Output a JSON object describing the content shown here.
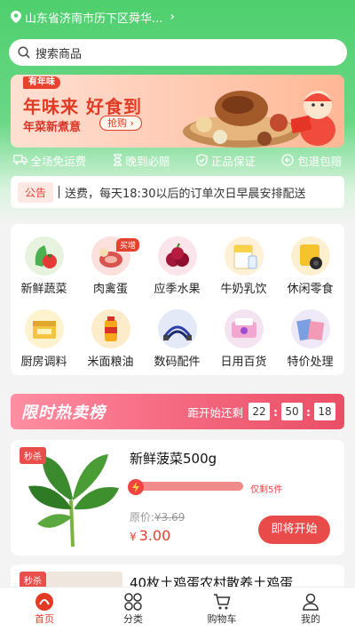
{
  "location": {
    "text": "山东省济南市历下区舜华...",
    "chevron": "›"
  },
  "search": {
    "placeholder": "搜索商品"
  },
  "banner": {
    "tag": "有年味",
    "title": "年味来 好食到",
    "subtitle": "年菜新煮意",
    "button": "抢购 ›"
  },
  "features": [
    {
      "icon": "truck-icon",
      "label": "全场免运费"
    },
    {
      "icon": "hourglass-icon",
      "label": "晚到必赔"
    },
    {
      "icon": "shield-check-icon",
      "label": "正品保证"
    },
    {
      "icon": "return-icon",
      "label": "包退包赔"
    }
  ],
  "notice": {
    "label": "公告",
    "text": "送费，每天18:30以后的订单次日早晨安排配送"
  },
  "categories": [
    {
      "label": "新鲜蔬菜",
      "icon": "vegetables-icon",
      "color": "#e7f3df"
    },
    {
      "label": "肉禽蛋",
      "icon": "meat-icon",
      "color": "#fbe0dd",
      "badge": "买增"
    },
    {
      "label": "应季水果",
      "icon": "fruit-icon",
      "color": "#f9e5ea"
    },
    {
      "label": "牛奶乳饮",
      "icon": "milk-icon",
      "color": "#fff1d7"
    },
    {
      "label": "休闲零食",
      "icon": "snacks-icon",
      "color": "#fdf0d0"
    },
    {
      "label": "厨房调料",
      "icon": "seasoning-icon",
      "color": "#fdf3cf"
    },
    {
      "label": "米面粮油",
      "icon": "oil-icon",
      "color": "#fdecc9"
    },
    {
      "label": "数码配件",
      "icon": "cable-icon",
      "color": "#e4e9f8"
    },
    {
      "label": "日用百货",
      "icon": "tissue-icon",
      "color": "#f4e4f2"
    },
    {
      "label": "特价处理",
      "icon": "sale-icon",
      "color": "#efe8f7"
    }
  ],
  "flash": {
    "title": "限时热卖榜",
    "countdown_label": "距开始还剩",
    "hours": "22",
    "minutes": "50",
    "seconds": "18"
  },
  "product": {
    "badge": "秒杀",
    "name": "新鲜菠菜500g",
    "remaining": "仅剩5件",
    "progress": 1.0,
    "orig_label": "原价:",
    "orig_price": "¥3.69",
    "currency": "¥",
    "price": "3.00",
    "button": "即将开始"
  },
  "product2": {
    "badge": "秒杀",
    "name": "40枚土鸡蛋农村散养土鸡蛋"
  },
  "tabbar": [
    {
      "label": "首页",
      "icon": "home-icon",
      "active": true
    },
    {
      "label": "分类",
      "icon": "category-icon",
      "active": false
    },
    {
      "label": "购物车",
      "icon": "cart-icon",
      "active": false
    },
    {
      "label": "我的",
      "icon": "user-icon",
      "active": false
    }
  ],
  "colors": {
    "brand_green": "#4fcf6e",
    "accent_red": "#e94b4b"
  }
}
